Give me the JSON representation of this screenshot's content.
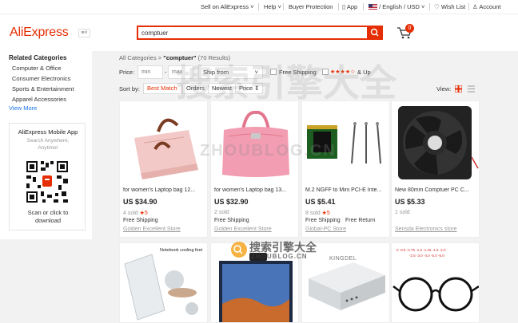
{
  "topbar": {
    "sell": "Sell on AliExpress",
    "help": "Help",
    "buyer": "Buyer Protection",
    "app": "App",
    "lang": "/ English / USD",
    "wishlist": "Wish List",
    "account": "Account"
  },
  "header": {
    "logo": "AliExpress",
    "search_value": "comptuer",
    "cart_count": "0"
  },
  "sidebar": {
    "title": "Related Categories",
    "items": [
      "Computer & Office",
      "Consumer Electronics",
      "Sports & Entertainment",
      "Apparel Accessories"
    ],
    "view_more": "View More",
    "app_title": "AliExpress Mobile App",
    "app_sub1": "Search Anywhere,",
    "app_sub2": "Anytime!",
    "app_cta1": "Scan or click to",
    "app_cta2": "download"
  },
  "breadcrumb": {
    "all": "All Categories",
    "sep": ">",
    "query": "\"comptuer\"",
    "count": "(70 Results)"
  },
  "filters": {
    "price_label": "Price:",
    "min_placeholder": "min",
    "dash": "-",
    "max_placeholder": "max",
    "ship_from": "Ship from",
    "free_shipping": "Free Shipping",
    "stars": "★★★★☆",
    "and_up": "& Up"
  },
  "sort": {
    "label": "Sort by:",
    "tabs": [
      "Best Match",
      "Orders",
      "Newest",
      "Price ⇕"
    ],
    "view_label": "View:"
  },
  "products": [
    {
      "title": "for women's Laptop bag 12...",
      "price": "US $34.90",
      "sold": "4 sold",
      "rating": "5",
      "ship": "Free Shipping",
      "ship2": "",
      "store": "Golden Excellent Store"
    },
    {
      "title": "for women's Laptop bag 13...",
      "price": "US $32.90",
      "sold": "2 sold",
      "rating": "",
      "ship": "Free Shipping",
      "ship2": "",
      "store": "Golden Excellent Store"
    },
    {
      "title": "M.2 NGFF to Mini PCI-E Inte...",
      "price": "US $5.41",
      "sold": "8 sold",
      "rating": "5",
      "ship": "Free Shipping",
      "ship2": "Free Return",
      "store": "Global-PC Store"
    },
    {
      "title": "New 80mm Comptuer PC C...",
      "price": "US $5.33",
      "sold": "1 sold",
      "rating": "",
      "ship": "",
      "ship2": "",
      "store": "Sensda Electronics store"
    }
  ],
  "row2_labels": {
    "cooling": "Notebook cooling feet",
    "brand": "KINGDEL",
    "lens": "0 -0.5 -0.75 -1.0 -1.25 -1.5 -2.0",
    "lens2": "-2.5 -3.0 -4.0 -5.0 -6.0"
  },
  "watermark": {
    "site": "ZHOUBLOG.CN",
    "cn": "搜索引擎大全"
  },
  "colors": {
    "brand": "#e62e04",
    "link": "#1a73e8"
  }
}
